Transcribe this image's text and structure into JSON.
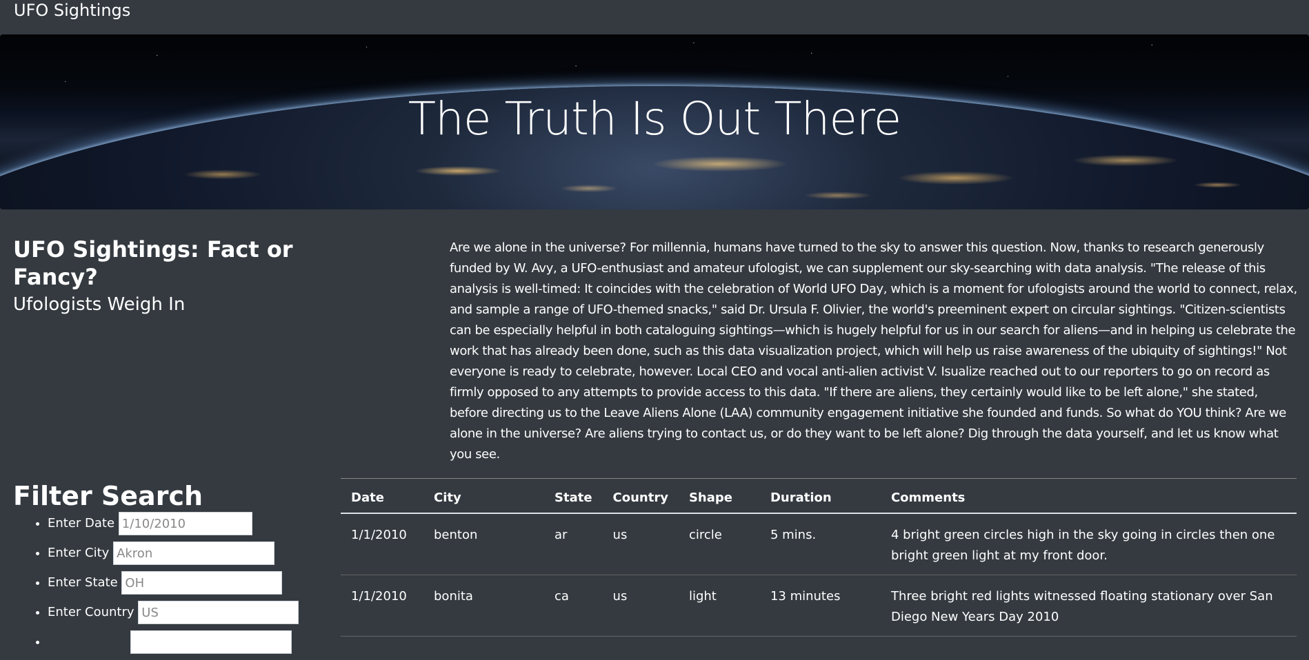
{
  "navbar": {
    "brand": "UFO Sightings"
  },
  "hero": {
    "title": "The Truth Is Out There"
  },
  "intro": {
    "title": "UFO Sightings: Fact or Fancy?",
    "subtitle": "Ufologists Weigh In",
    "article": "Are we alone in the universe? For millennia, humans have turned to the sky to answer this question. Now, thanks to research generously funded by W. Avy, a UFO-enthusiast and amateur ufologist, we can supplement our sky-searching with data analysis. \"The release of this analysis is well-timed: It coincides with the celebration of World UFO Day, which is a moment for ufologists around the world to connect, relax, and sample a range of UFO-themed snacks,\" said Dr. Ursula F. Olivier, the world's preeminent expert on circular sightings. \"Citizen-scientists can be especially helpful in both cataloguing sightings—which is hugely helpful for us in our search for aliens—and in helping us celebrate the work that has already been done, such as this data visualization project, which will help us raise awareness of the ubiquity of sightings!\" Not everyone is ready to celebrate, however. Local CEO and vocal anti-alien activist V. Isualize reached out to our reporters to go on record as firmly opposed to any attempts to provide access to this data. \"If there are aliens, they certainly would like to be left alone,\" she stated, before directing us to the Leave Aliens Alone (LAA) community engagement initiative she founded and funds. So what do YOU think? Are we alone in the universe? Are aliens trying to contact us, or do they want to be left alone? Dig through the data yourself, and let us know what you see."
  },
  "filters": {
    "title": "Filter Search",
    "items": [
      {
        "label": "Enter Date",
        "placeholder": "1/10/2010",
        "value": ""
      },
      {
        "label": "Enter City",
        "placeholder": "Akron",
        "value": ""
      },
      {
        "label": "Enter State",
        "placeholder": "OH",
        "value": ""
      },
      {
        "label": "Enter Country",
        "placeholder": "US",
        "value": ""
      },
      {
        "label": "",
        "placeholder": "",
        "value": ""
      }
    ]
  },
  "table": {
    "headers": [
      "Date",
      "City",
      "State",
      "Country",
      "Shape",
      "Duration",
      "Comments"
    ],
    "rows": [
      [
        "1/1/2010",
        "benton",
        "ar",
        "us",
        "circle",
        "5 mins.",
        "4 bright green circles high in the sky going in circles then one bright green light at my front door."
      ],
      [
        "1/1/2010",
        "bonita",
        "ca",
        "us",
        "light",
        "13 minutes",
        "Three bright red lights witnessed floating stationary over San Diego New Years Day 2010"
      ]
    ]
  }
}
